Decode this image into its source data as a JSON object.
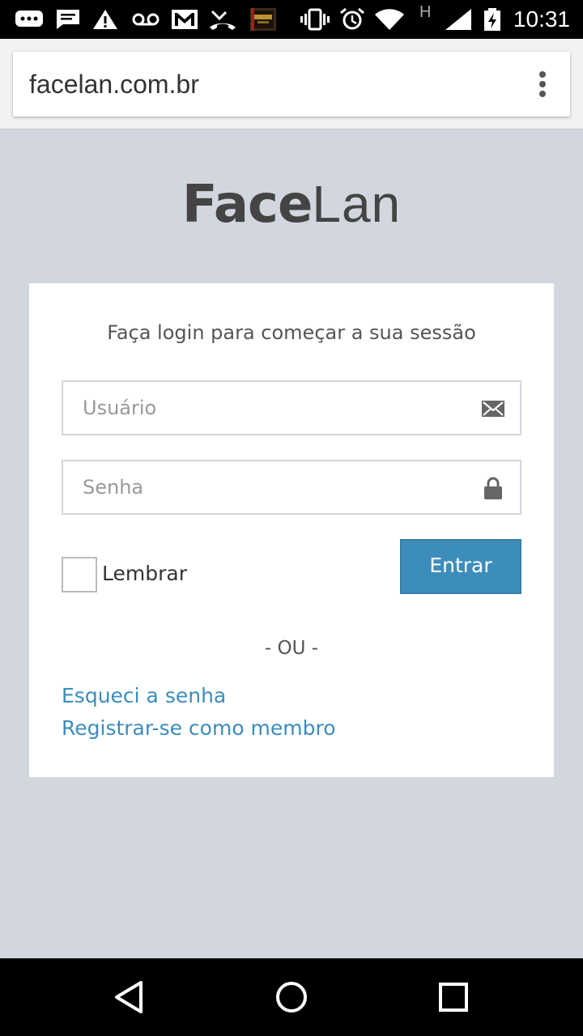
{
  "status_bar": {
    "time": "10:31",
    "network_type": "H",
    "icons": [
      "sms-icon",
      "message-icon",
      "warning-icon",
      "voicemail-icon",
      "gmail-icon",
      "missed-call-icon",
      "app-thumbnail-icon",
      "vibrate-icon",
      "alarm-icon",
      "wifi-icon",
      "signal-icon",
      "battery-charging-icon"
    ]
  },
  "browser": {
    "url": "facelan.com.br",
    "menu_icon": "overflow-menu-icon"
  },
  "logo": {
    "bold": "Face",
    "light": "Lan"
  },
  "login": {
    "message": "Faça login para começar a sua sessão",
    "username_placeholder": "Usuário",
    "username_value": "",
    "username_icon": "envelope-icon",
    "password_placeholder": "Senha",
    "password_value": "",
    "password_icon": "lock-icon",
    "remember_label": "Lembrar",
    "remember_checked": false,
    "submit_label": "Entrar",
    "divider": "- OU -",
    "forgot_link": "Esqueci a senha",
    "register_link": "Registrar-se como membro"
  },
  "colors": {
    "page_bg": "#d2d6de",
    "primary": "#3c8dbc",
    "card_bg": "#ffffff"
  },
  "nav_bar": {
    "buttons": [
      "back-icon",
      "home-icon",
      "recents-icon"
    ]
  }
}
